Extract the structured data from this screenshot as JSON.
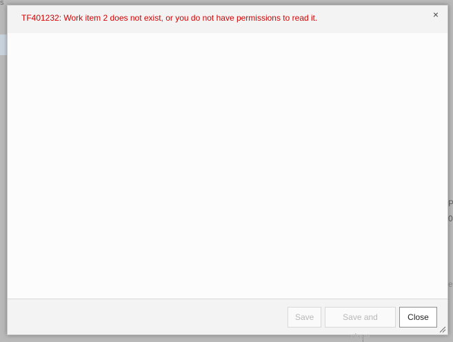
{
  "dialog": {
    "error_message": "TF401232: Work item 2 does not exist, or you do not have permissions to read it.",
    "close_icon": "close-icon",
    "close_glyph": "×"
  },
  "footer": {
    "save_label": "Save",
    "save_and_close_label": "Save and close",
    "close_label": "Close"
  },
  "background": {
    "top_left_fragment": "s",
    "right_fragments": [
      "P",
      "0"
    ],
    "right_fragment_bottom": "er"
  },
  "colors": {
    "error_text": "#d20000",
    "overlay": "#b9b9b9",
    "dialog_bg": "#fcfcfc"
  }
}
